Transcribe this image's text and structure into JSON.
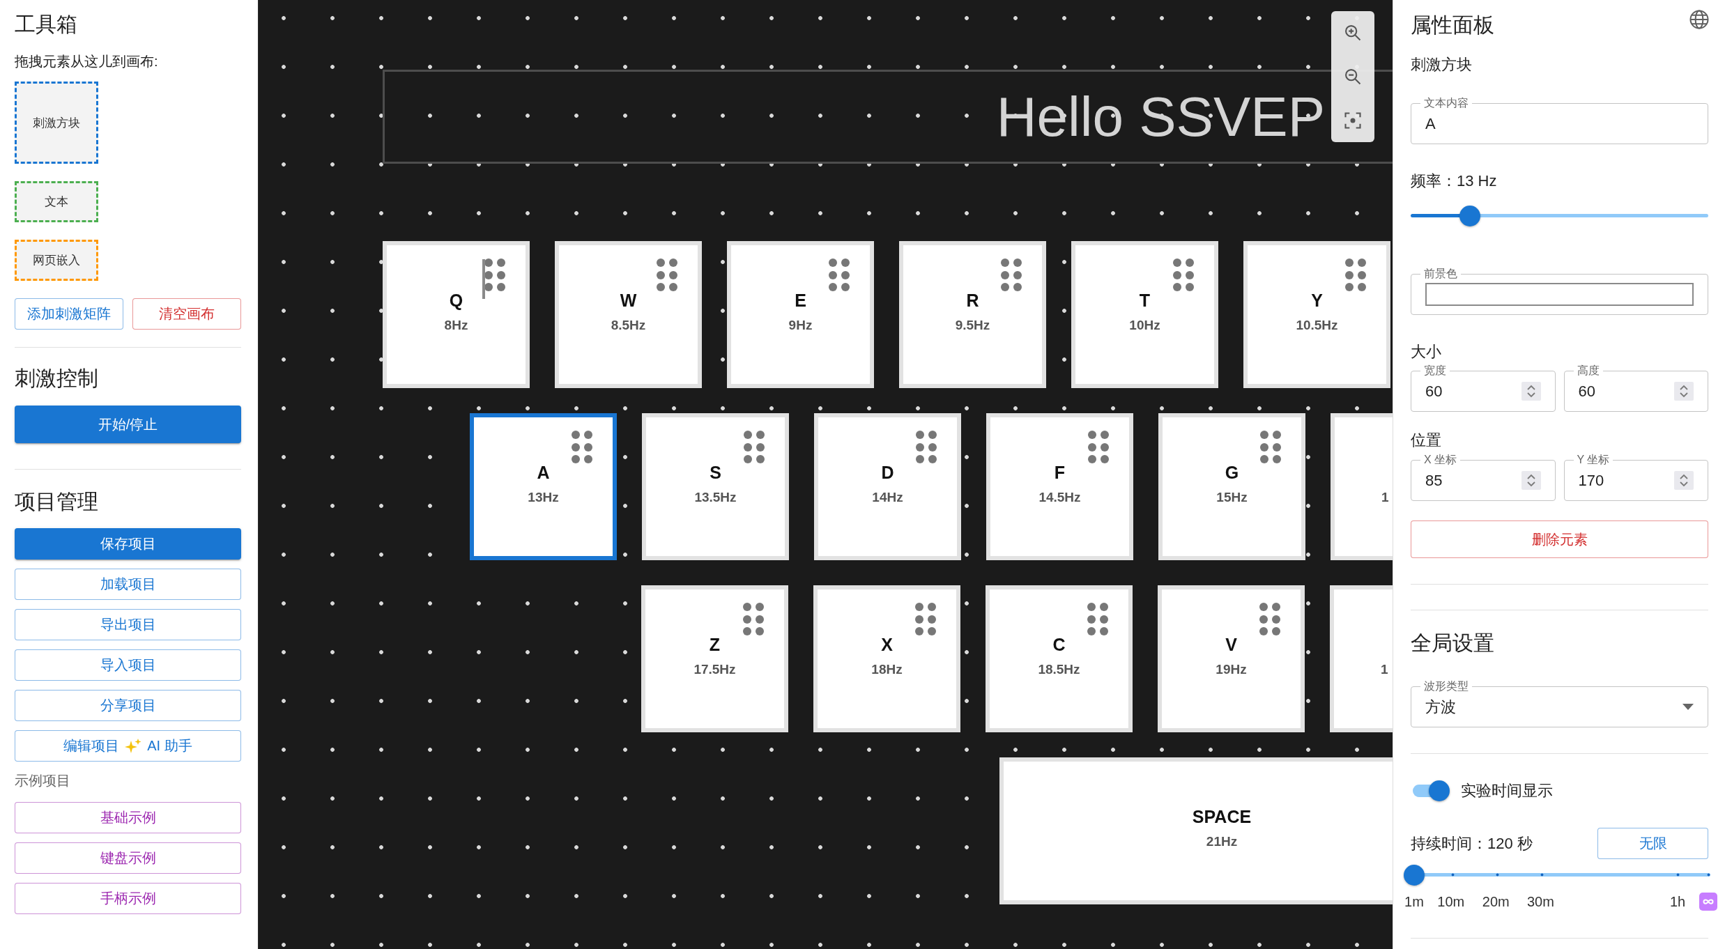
{
  "toolbox": {
    "title": "工具箱",
    "hint": "拖拽元素从这儿到画布:",
    "items": [
      {
        "label": "刺激方块",
        "kind": "block",
        "color": "#1976d2"
      },
      {
        "label": "文本",
        "kind": "text",
        "color": "#4caf50"
      },
      {
        "label": "网页嵌入",
        "kind": "embed",
        "color": "#ff9800"
      }
    ],
    "buttons": [
      {
        "label": "添加刺激矩阵",
        "kind": "primary"
      },
      {
        "label": "清空画布",
        "kind": "danger"
      }
    ]
  },
  "stimulus_control": {
    "title": "刺激控制",
    "button": "开始/停止"
  },
  "project_management": {
    "title": "项目管理",
    "buttons": [
      {
        "label": "保存项目",
        "kind": "contained"
      },
      {
        "label": "加载项目",
        "kind": "primary"
      },
      {
        "label": "导出项目",
        "kind": "primary"
      },
      {
        "label": "导入项目",
        "kind": "primary"
      },
      {
        "label": "分享项目",
        "kind": "primary"
      },
      {
        "label": "编辑项目",
        "kind": "primary",
        "assistant_label": "AI 助手"
      }
    ],
    "examples_title": "示例项目",
    "examples": [
      "基础示例",
      "键盘示例",
      "手柄示例"
    ]
  },
  "canvas": {
    "text_element": "Hello SSVEP",
    "rows": [
      [
        {
          "kind": "key",
          "label": "Q",
          "frequency": "8Hz",
          "selected": false,
          "hovered": true
        },
        {
          "kind": "key",
          "label": "W",
          "frequency": "8.5Hz",
          "selected": false,
          "hovered": false
        },
        {
          "kind": "key",
          "label": "E",
          "frequency": "9Hz",
          "selected": false,
          "hovered": false
        },
        {
          "kind": "key",
          "label": "R",
          "frequency": "9.5Hz",
          "selected": false,
          "hovered": false
        },
        {
          "kind": "key",
          "label": "T",
          "frequency": "10Hz",
          "selected": false,
          "hovered": false
        },
        {
          "kind": "key",
          "label": "Y",
          "frequency": "10.5Hz",
          "selected": false,
          "hovered": false
        }
      ],
      [
        {
          "kind": "key",
          "label": "A",
          "frequency": "13Hz",
          "selected": true,
          "hovered": false
        },
        {
          "kind": "key",
          "label": "S",
          "frequency": "13.5Hz",
          "selected": false,
          "hovered": false
        },
        {
          "kind": "key",
          "label": "D",
          "frequency": "14Hz",
          "selected": false,
          "hovered": false
        },
        {
          "kind": "key",
          "label": "F",
          "frequency": "14.5Hz",
          "selected": false,
          "hovered": false
        },
        {
          "kind": "key",
          "label": "G",
          "frequency": "15Hz",
          "selected": false,
          "hovered": false
        },
        {
          "kind": "cut",
          "frequency": "1",
          "selected": false,
          "hovered": false
        }
      ],
      [
        {
          "kind": "key",
          "label": "Z",
          "frequency": "17.5Hz",
          "selected": false,
          "hovered": false
        },
        {
          "kind": "key",
          "label": "X",
          "frequency": "18Hz",
          "selected": false,
          "hovered": false
        },
        {
          "kind": "key",
          "label": "C",
          "frequency": "18.5Hz",
          "selected": false,
          "hovered": false
        },
        {
          "kind": "key",
          "label": "V",
          "frequency": "19Hz",
          "selected": false,
          "hovered": false
        },
        {
          "kind": "cut",
          "frequency": "1",
          "selected": false,
          "hovered": false
        }
      ],
      [
        {
          "kind": "wide",
          "label": "SPACE",
          "frequency": "21Hz",
          "selected": false,
          "hovered": false
        }
      ]
    ]
  },
  "properties": {
    "title": "属性面板",
    "element_type": "刺激方块",
    "text_content": {
      "label": "文本内容",
      "value": "A"
    },
    "frequency": {
      "reading": "频率：13 Hz",
      "level": 0.2
    },
    "foreground_color": {
      "label": "前景色"
    },
    "size": {
      "title": "大小",
      "fields": [
        {
          "label": "宽度",
          "value": "60"
        },
        {
          "label": "高度",
          "value": "60"
        }
      ]
    },
    "position": {
      "title": "位置",
      "fields": [
        {
          "label": "X 坐标",
          "value": "85"
        },
        {
          "label": "Y 坐标",
          "value": "170"
        }
      ]
    },
    "delete_button": "删除元素"
  },
  "global_settings": {
    "title": "全局设置",
    "waveform": {
      "label": "波形类型",
      "value": "方波"
    },
    "time_display": {
      "label": "实验时间显示",
      "on": true
    },
    "duration": {
      "reading": "持续时间：120 秒",
      "button": "无限",
      "level": 0,
      "marks": [
        "1m",
        "10m",
        "20m",
        "30m",
        "1h"
      ]
    }
  }
}
